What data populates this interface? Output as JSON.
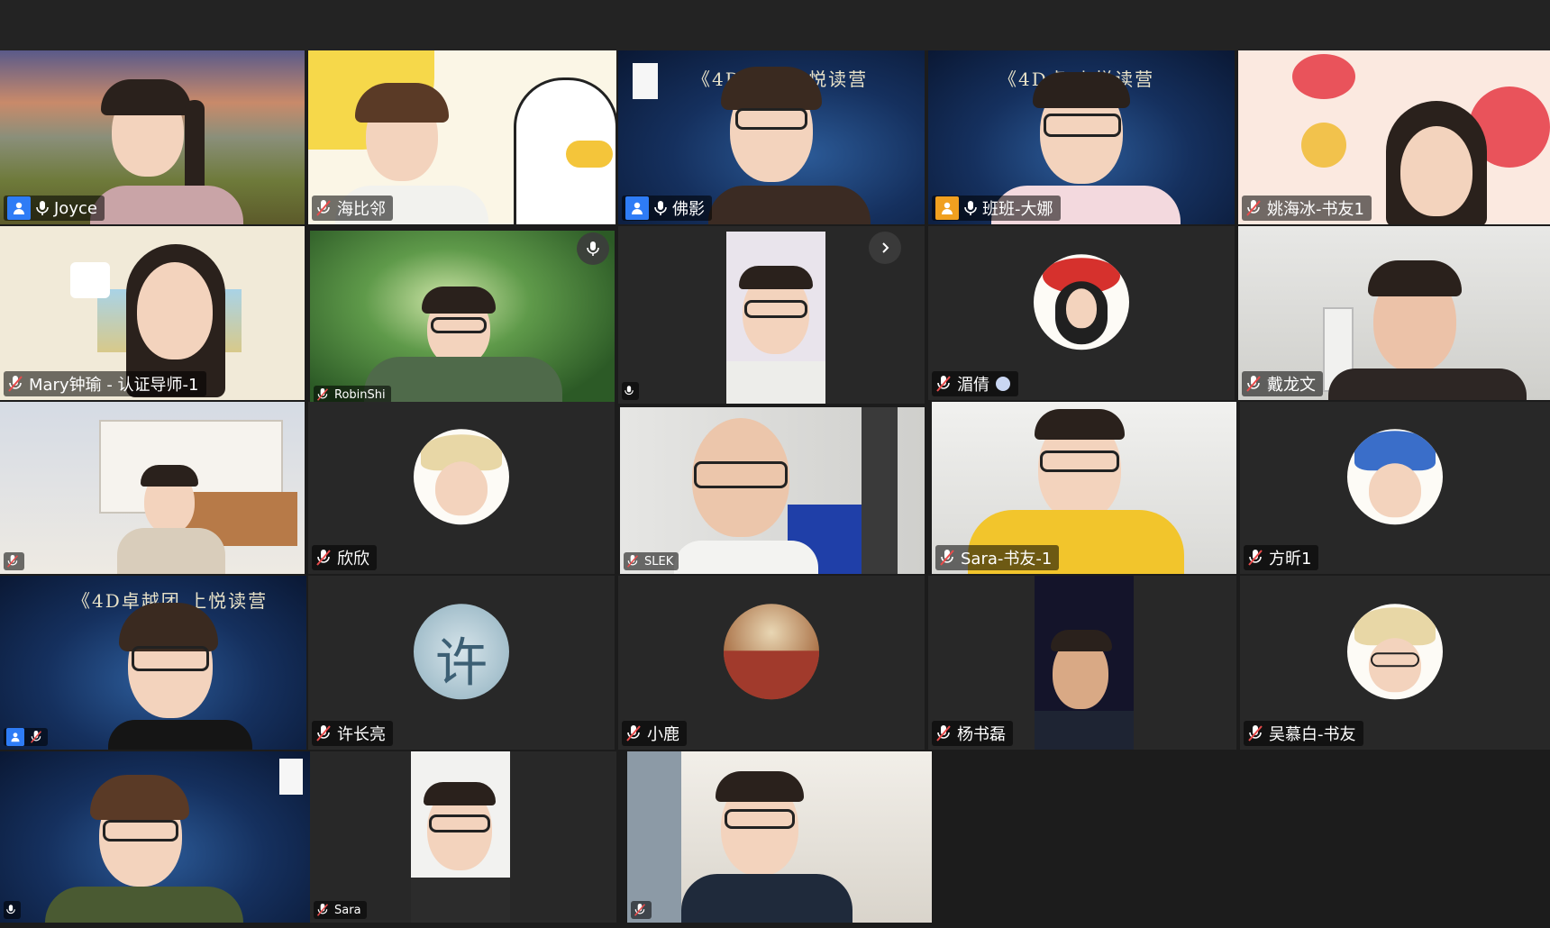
{
  "participants": [
    {
      "name": "Joyce"
    },
    {
      "name": "海比邻"
    },
    {
      "name": "佛影"
    },
    {
      "name": "班班-大娜"
    },
    {
      "name": "姚海冰-书友1"
    },
    {
      "name": "Mary钟瑜 - 认证导师-1"
    },
    {
      "name": "RobinShi"
    },
    {
      "name": "湄倩"
    },
    {
      "name": "戴龙文"
    },
    {
      "name": "欣欣"
    },
    {
      "name": "SLEK"
    },
    {
      "name": "Sara-书友-1"
    },
    {
      "name": "方昕1"
    },
    {
      "name": "许长亮"
    },
    {
      "name": "小鹿"
    },
    {
      "name": "杨书磊"
    },
    {
      "name": "吴慕白-书友"
    },
    {
      "name": "Sara"
    }
  ],
  "banners": {
    "fo_ying": "《4D卓越    上悦读营",
    "dana": "《4D卓    上悦读营",
    "zhou": "《4D卓越团    上悦读营"
  },
  "avatar_char": "许",
  "colors": {
    "accent_blue": "#2e7cf6",
    "accent_orange": "#f0a020",
    "muted_red": "#e94b4b"
  }
}
